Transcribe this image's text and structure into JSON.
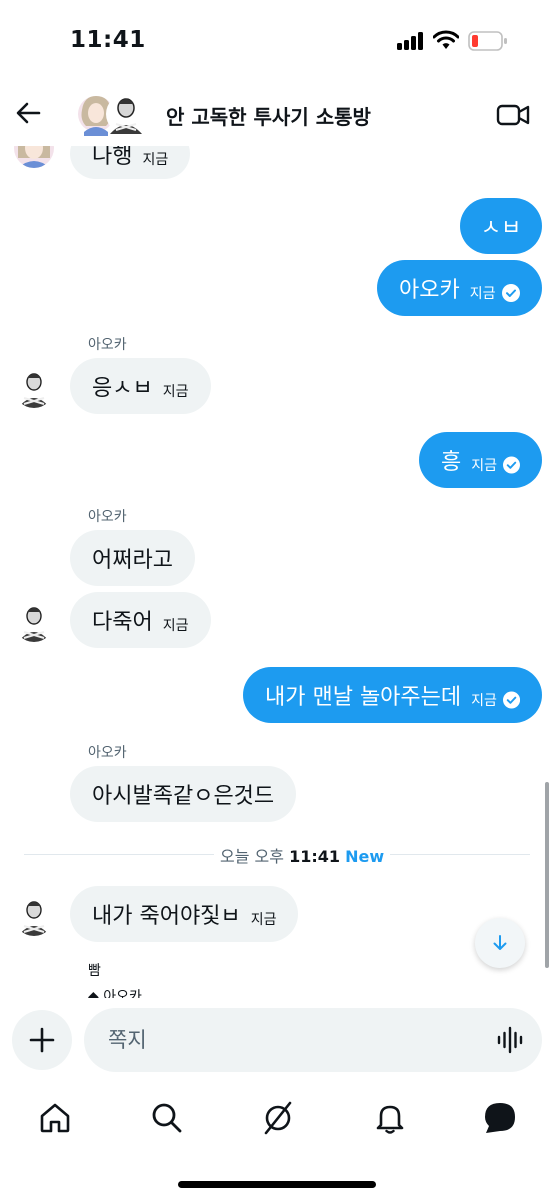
{
  "status": {
    "time": "11:41"
  },
  "header": {
    "title": "안 고독한 투사기 소통방"
  },
  "messages": {
    "top_partial": {
      "text": "나행",
      "time": "지금"
    },
    "out1": {
      "text": "ㅅㅂ"
    },
    "out2": {
      "text": "아오카",
      "time": "지금"
    },
    "group1": {
      "sender": "아오카",
      "text": "응ㅅㅂ",
      "time": "지금"
    },
    "out3": {
      "text": "흥",
      "time": "지금"
    },
    "group2": {
      "sender": "아오카",
      "text1": "어쩌라고",
      "text2": "다죽어",
      "time": "지금"
    },
    "out4": {
      "text": "내가 맨날 놀아주는데",
      "time": "지금"
    },
    "group3": {
      "sender": "아오카",
      "text": "아시발족같ㅇ은것드"
    },
    "divider": {
      "prefix": "오늘 오후",
      "time": "11:41",
      "new": "New"
    },
    "group4": {
      "text": "내가 죽어야짗ㅂ",
      "time": "지금"
    },
    "bottom_partial": {
      "sender": "빰",
      "reply": "◆ 아오카"
    }
  },
  "composer": {
    "placeholder": "쪽지"
  },
  "tabs": [
    "home-icon",
    "search-icon",
    "grok-icon",
    "notifications-icon",
    "messages-icon"
  ],
  "colors": {
    "accent": "#1d9bf0",
    "bubble_in": "#eff3f4",
    "text": "#0f1419",
    "muted": "#536471"
  }
}
